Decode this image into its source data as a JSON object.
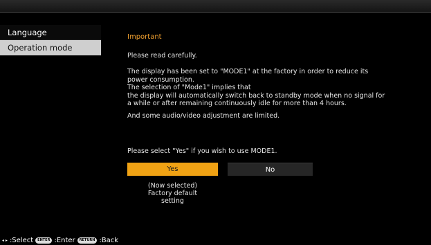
{
  "sidebar": {
    "items": [
      {
        "label": "Language"
      },
      {
        "label": "Operation mode"
      }
    ]
  },
  "main": {
    "title": "Important",
    "lines": [
      "Please read carefully.",
      "The display has been set to \"MODE1\" at the factory in order to reduce its",
      "power consumption.",
      "The selection of  \"Mode1\" implies that",
      "the display will automatically switch back to standby mode when no signal for",
      "a while or after remaining continuously idle for more than 4 hours.",
      "And some audio/video adjustment are limited."
    ],
    "prompt": "Please select \"Yes\" if you wish to use MODE1.",
    "buttons": {
      "yes": "Yes",
      "no": "No"
    },
    "note": [
      "(Now selected)",
      "Factory default",
      "setting"
    ]
  },
  "footer": {
    "arrows": "◂ ▸",
    "select": ":Select",
    "enter_key": "ENTER",
    "enter": ":Enter",
    "return_key": "RETURN",
    "back": ":Back"
  },
  "colors": {
    "accent": "#f0a214",
    "selected_bg": "#cfcfcf",
    "title": "#f0a030"
  }
}
